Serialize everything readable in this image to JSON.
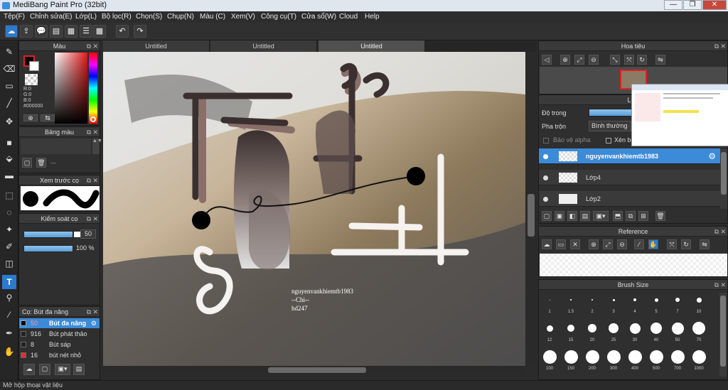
{
  "app": {
    "title": "MediBang Paint Pro (32bit)"
  },
  "window_buttons": {
    "minimize": "—",
    "maximize": "❐",
    "close": "✕"
  },
  "menu": [
    "Tệp(F)",
    "Chỉnh sửa(E)",
    "Lớp(L)",
    "Bộ lọc(R)",
    "Chọn(S)",
    "Chụp(N)",
    "Màu (C)",
    "Xem(V)",
    "Công cụ(T)",
    "Cửa sổ(W)",
    "Cloud",
    "Help"
  ],
  "tabs": [
    "Untitled",
    "Untitled",
    "Untitled"
  ],
  "active_tab_index": 2,
  "color_panel": {
    "title": "Màu",
    "rgb": {
      "r": "R:0",
      "g": "G:0",
      "b": "B:0"
    },
    "hex": "#000000",
    "primary_color": "#000000",
    "secondary_color": "#ffffff"
  },
  "palette_panel": {
    "title": "Bảng màu",
    "empty_text": "---"
  },
  "preview_panel": {
    "title": "Xem trước cọ"
  },
  "brush_control": {
    "title": "Kiểm soát cọ",
    "size_value": "50",
    "opacity_value": "100 %",
    "opacity_fraction": 1.0
  },
  "brush_list": {
    "title": "Cọ: Bút đa năng",
    "items": [
      {
        "size": "50",
        "name": "Bút đa năng",
        "selected": true
      },
      {
        "size": "916",
        "name": "Bút phát thảo",
        "selected": false
      },
      {
        "size": "8",
        "name": "Bút sáp",
        "selected": false
      },
      {
        "size": "16",
        "name": "bút nét nhỏ",
        "selected": false
      }
    ]
  },
  "canvas_text": {
    "line1": "nguyenvankhiemtb1983",
    "line2": "--Chi--",
    "line3": "hd247"
  },
  "navigator": {
    "title": "Hoa tiêu"
  },
  "layer_panel": {
    "title": "Lớp",
    "opacity_label": "Độ trong",
    "blend_label": "Pha trộn",
    "blend_value": "Bình thường",
    "protect_alpha": "Bảo vệ alpha",
    "clip_label": "Xén bớ",
    "layers": [
      {
        "name": "nguyenvankhiemtb1983",
        "selected": true
      },
      {
        "name": "Lớp4",
        "selected": false
      },
      {
        "name": "Lớp2",
        "selected": false
      }
    ]
  },
  "reference_panel": {
    "title": "Reference"
  },
  "brush_size_panel": {
    "title": "Brush Size",
    "sizes": [
      "1",
      "1.5",
      "2",
      "3",
      "4",
      "5",
      "7",
      "10",
      "12",
      "15",
      "20",
      "25",
      "30",
      "40",
      "50",
      "70",
      "100",
      "150",
      "200",
      "300",
      "400",
      "500",
      "700",
      "1000"
    ]
  },
  "status": {
    "text": "Mở hộp thoại vật liệu"
  }
}
